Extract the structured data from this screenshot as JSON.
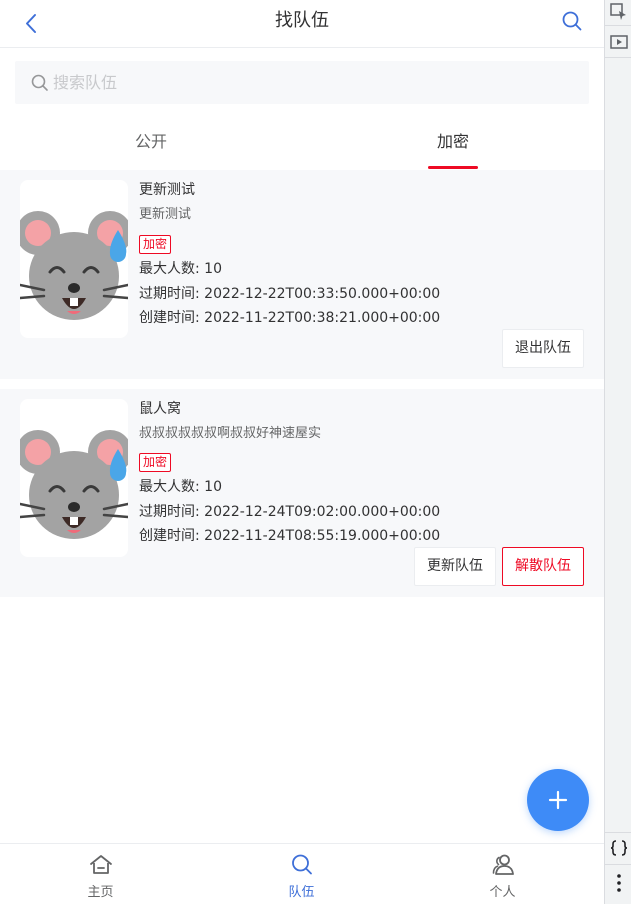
{
  "navbar": {
    "title": "找队伍",
    "back_icon": "chevron-left-icon",
    "search_icon": "search-icon"
  },
  "search": {
    "placeholder": "搜索队伍",
    "value": ""
  },
  "tabs": [
    {
      "label": "公开",
      "active": false
    },
    {
      "label": "加密",
      "active": true
    }
  ],
  "teams": [
    {
      "name": "更新测试",
      "description": "更新测试",
      "tag": "加密",
      "max_members": "最大人数: 10",
      "expire_time": "过期时间: 2022-12-22T00:33:50.000+00:00",
      "create_time": "创建时间: 2022-11-22T00:38:21.000+00:00",
      "buttons": [
        "退出队伍"
      ]
    },
    {
      "name": "鼠人窝",
      "description": "叔叔叔叔叔叔啊叔叔好神速屋实",
      "tag": "加密",
      "max_members": "最大人数: 10",
      "expire_time": "过期时间: 2022-12-24T09:02:00.000+00:00",
      "create_time": "创建时间: 2022-11-24T08:55:19.000+00:00",
      "buttons": [
        "更新队伍",
        "解散队伍"
      ]
    }
  ],
  "fab": {
    "icon": "plus-icon"
  },
  "tabbar": [
    {
      "label": "主页",
      "icon": "home-icon",
      "active": false
    },
    {
      "label": "队伍",
      "icon": "search-icon",
      "active": true
    },
    {
      "label": "个人",
      "icon": "friends-icon",
      "active": false
    }
  ],
  "colors": {
    "accent": "#3e8bf7",
    "danger": "#ee0a24",
    "card_bg": "#f7f8fa"
  }
}
